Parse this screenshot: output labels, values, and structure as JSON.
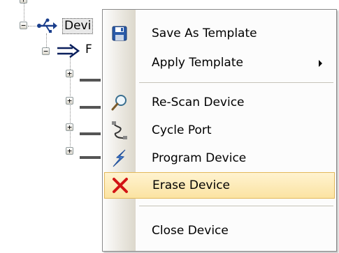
{
  "tree": {
    "device_label": "Devi",
    "child_label": "F"
  },
  "menu": {
    "items": [
      {
        "label": "Save As Template",
        "icon": "floppy-disk-icon"
      },
      {
        "label": "Apply Template",
        "icon": "",
        "submenu": true
      },
      {
        "label": "Re-Scan Device",
        "icon": "magnifier-icon"
      },
      {
        "label": "Cycle Port",
        "icon": "cable-icon"
      },
      {
        "label": "Program Device",
        "icon": "lightning-icon"
      },
      {
        "label": "Erase Device",
        "icon": "red-x-icon",
        "highlighted": true
      },
      {
        "label": "Close Device",
        "icon": ""
      }
    ]
  },
  "colors": {
    "highlight_fill": "#fbe3a2",
    "highlight_border": "#e3b85a",
    "erase_icon": "#d21414"
  }
}
